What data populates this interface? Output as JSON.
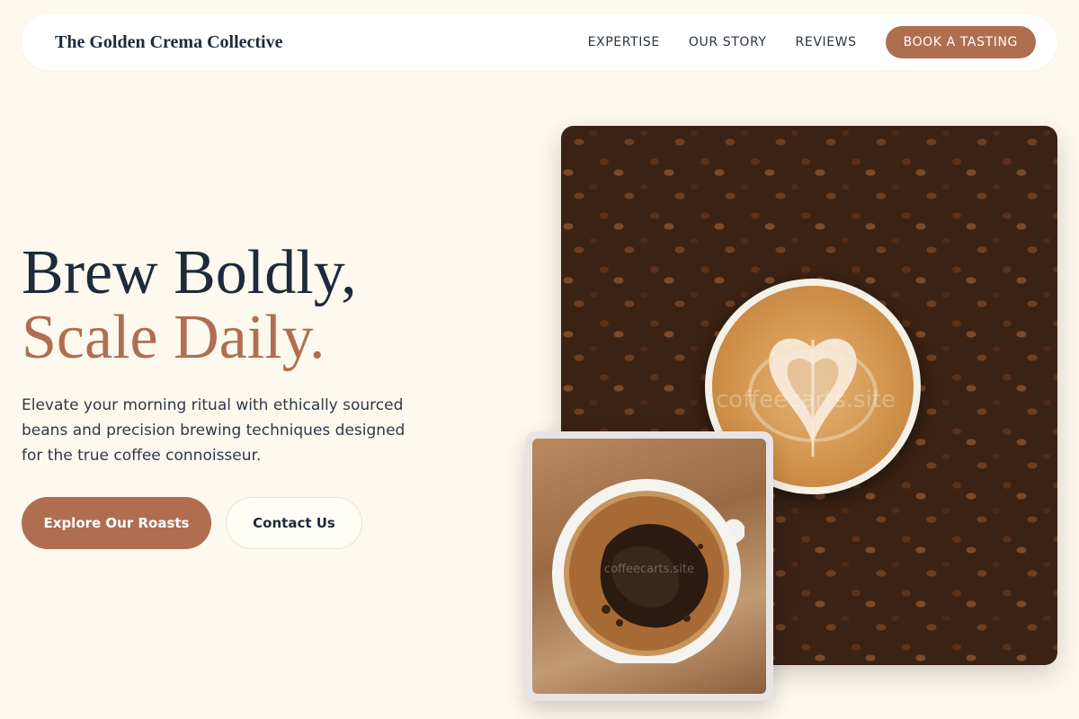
{
  "header": {
    "brand": "The Golden Crema Collective",
    "nav": [
      "EXPERTISE",
      "OUR STORY",
      "REVIEWS"
    ],
    "cta": "BOOK A TASTING"
  },
  "hero": {
    "headline_line1": "Brew Boldly,",
    "headline_line2": "Scale Daily.",
    "subtext": "Elevate your morning ritual with ethically sourced beans and precision brewing techniques designed for the true coffee connoisseur.",
    "primary_button": "Explore Our Roasts",
    "secondary_button": "Contact Us"
  },
  "images": {
    "main_watermark": "coffeecarts.site",
    "inset_watermark": "coffeecarts.site"
  },
  "colors": {
    "accent": "#b06e50",
    "dark": "#1e2a3c",
    "background": "#fdf9ee"
  }
}
